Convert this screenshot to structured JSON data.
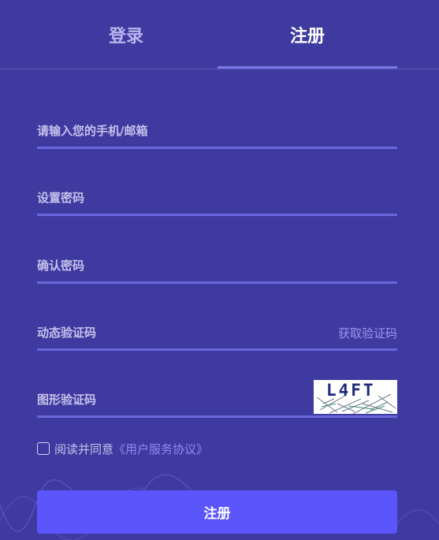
{
  "tabs": {
    "login": "登录",
    "register": "注册"
  },
  "fields": {
    "account": {
      "placeholder": "请输入您的手机/邮箱",
      "value": ""
    },
    "password": {
      "placeholder": "设置密码",
      "value": ""
    },
    "confirm_password": {
      "placeholder": "确认密码",
      "value": ""
    },
    "sms_code": {
      "placeholder": "动态验证码",
      "value": "",
      "action": "获取验证码"
    },
    "captcha": {
      "placeholder": "图形验证码",
      "value": "",
      "image_text": "L4FT"
    }
  },
  "agreement": {
    "text": "阅读并同意",
    "link": "《用户服务协议》"
  },
  "submit": {
    "label": "注册"
  },
  "colors": {
    "background": "#3f3a9f",
    "accent": "#5b56fb",
    "field_line": "#6a66dc",
    "link": "#8f8bf0"
  }
}
